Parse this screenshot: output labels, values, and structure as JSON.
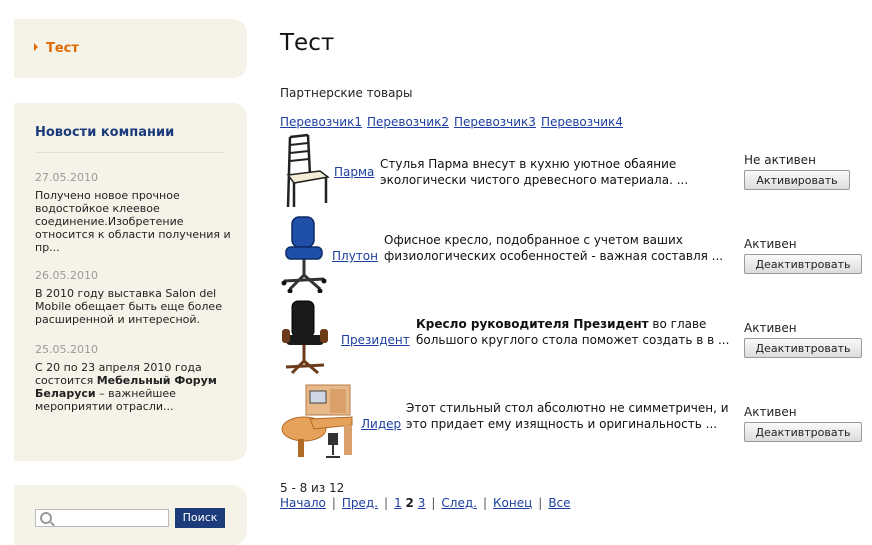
{
  "sidebar": {
    "nav_item": "Тест",
    "news": {
      "title": "Новости компании",
      "items": [
        {
          "date": "27.05.2010",
          "text": "Получено новое прочное водостойкое клеевое соединение.Изобретение относится к области получения и пр..."
        },
        {
          "date": "26.05.2010",
          "text": "В 2010 году выставка Salon del Mobile обещает быть еще более расширенной и интересной."
        },
        {
          "date": "25.05.2010",
          "text_pre": "С 20 по 23 апреля 2010 года состоится ",
          "text_bold": "Мебельный Форум Беларуси",
          "text_post": " – важнейшее мероприятии отрасли..."
        }
      ]
    },
    "search": {
      "placeholder": "",
      "button": "Поиск"
    }
  },
  "main": {
    "title": "Тест",
    "subtitle": "Партнерские товары",
    "carriers": [
      "Перевозчик1",
      "Перевозчик2",
      "Перевозчик3",
      "Перевозчик4"
    ],
    "products": [
      {
        "name": "Парма",
        "desc": "Стулья Парма внесут в кухню уютное обаяние экологически чистого древесного материала. ...",
        "status": "Не активен",
        "button": "Активировать"
      },
      {
        "name": "Плутон",
        "desc": "Офисное кресло, подобранное с учетом ваших физиологических особенностей - важная составля ...",
        "status": "Активен",
        "button": "Деактивтровать"
      },
      {
        "name": "Президент",
        "desc_bold": "Кресло руководителя Президент",
        "desc": " во главе большого круглого стола поможет создать в в ...",
        "status": "Активен",
        "button": "Деактивтровать"
      },
      {
        "name": "Лидер",
        "desc": "Этот стильный стол абсолютно не симметричен, и это придает ему изящность и оригинальность ...",
        "status": "Активен",
        "button": "Деактивтровать"
      }
    ],
    "count": "5 - 8 из 12",
    "pager": {
      "first": "Начало",
      "prev": "Пред.",
      "pages": [
        "1",
        "2",
        "3"
      ],
      "current": "2",
      "next": "След.",
      "last": "Конец",
      "all": "Все"
    }
  },
  "colors": {
    "accent": "#e06a00",
    "navy": "#1c3b7a",
    "link": "#1c3fa0",
    "panel": "#f5f2e8"
  }
}
